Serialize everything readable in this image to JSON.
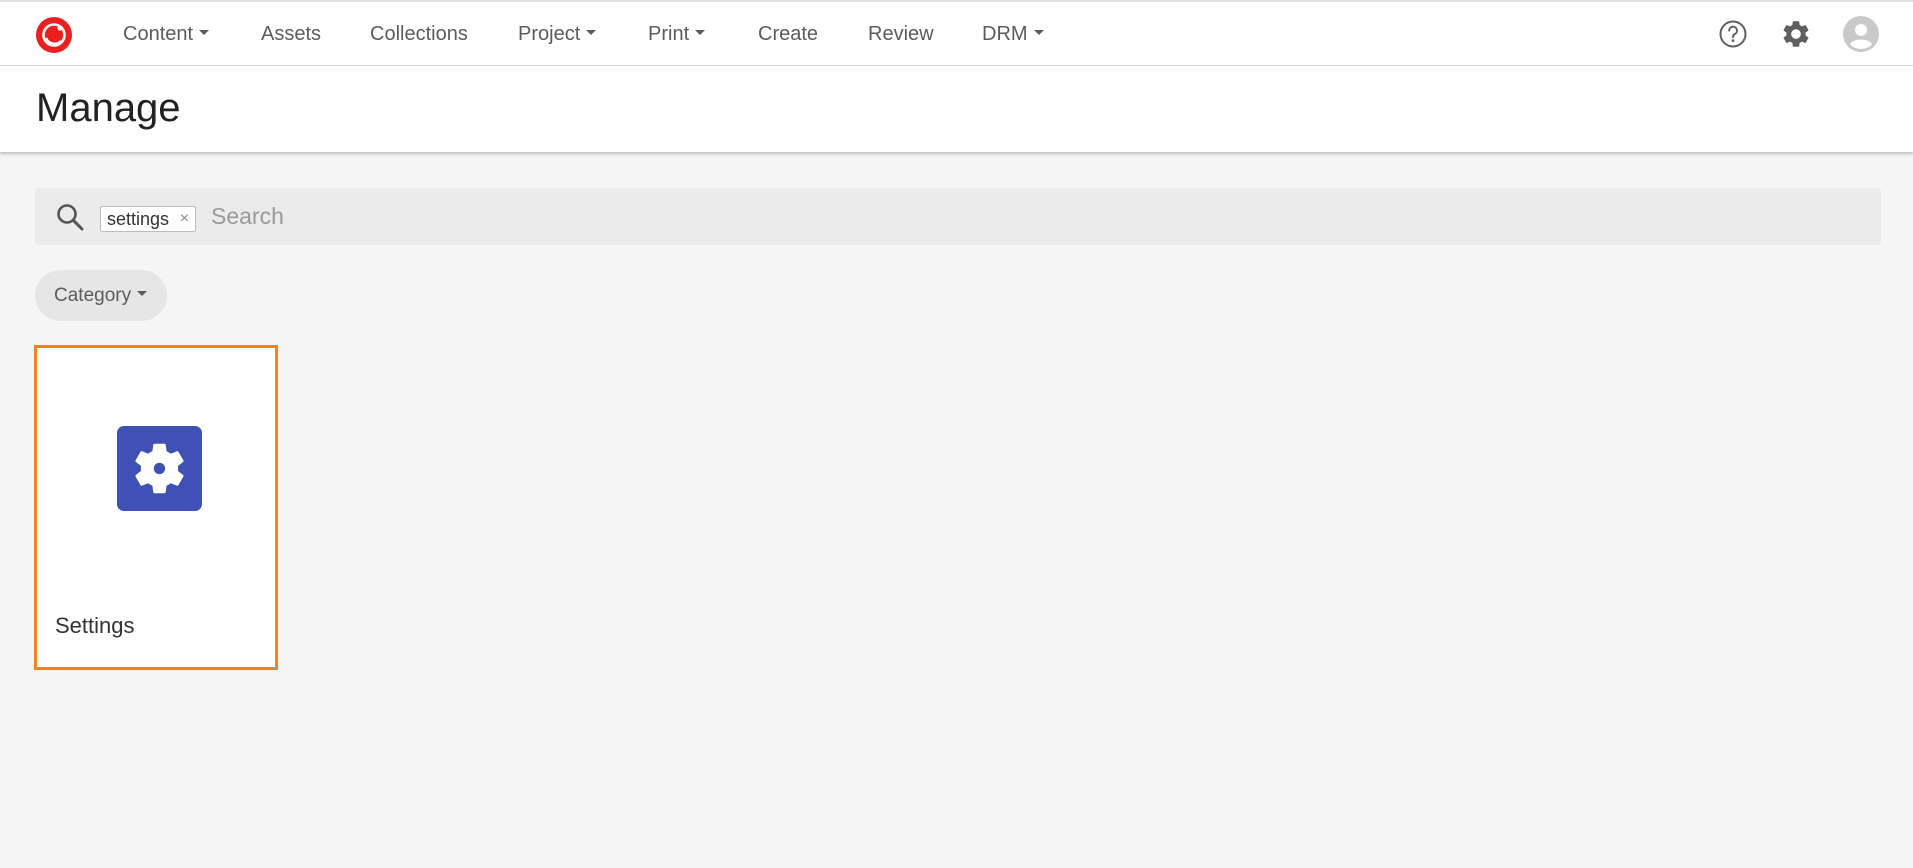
{
  "app": {
    "nav": [
      {
        "label": "Content",
        "has_dropdown": true
      },
      {
        "label": "Assets",
        "has_dropdown": false
      },
      {
        "label": "Collections",
        "has_dropdown": false
      },
      {
        "label": "Project",
        "has_dropdown": true
      },
      {
        "label": "Print",
        "has_dropdown": true
      },
      {
        "label": "Create",
        "has_dropdown": false
      },
      {
        "label": "Review",
        "has_dropdown": false
      },
      {
        "label": "DRM",
        "has_dropdown": true
      }
    ],
    "icons": {
      "logo": "sitecore-logo-icon",
      "help": "help-icon",
      "settings": "gear-icon",
      "user": "avatar-icon"
    },
    "colors": {
      "brand": "#eb1f1f",
      "accent": "#f58220",
      "tile": "#3f51b5"
    }
  },
  "header": {
    "title": "Manage"
  },
  "search": {
    "chip_label": "settings",
    "chip_remove": "×",
    "value": "",
    "placeholder": "Search"
  },
  "filters": {
    "category_label": "Category"
  },
  "cards": [
    {
      "label": "Settings",
      "icon": "gear-icon",
      "selected": true
    }
  ]
}
